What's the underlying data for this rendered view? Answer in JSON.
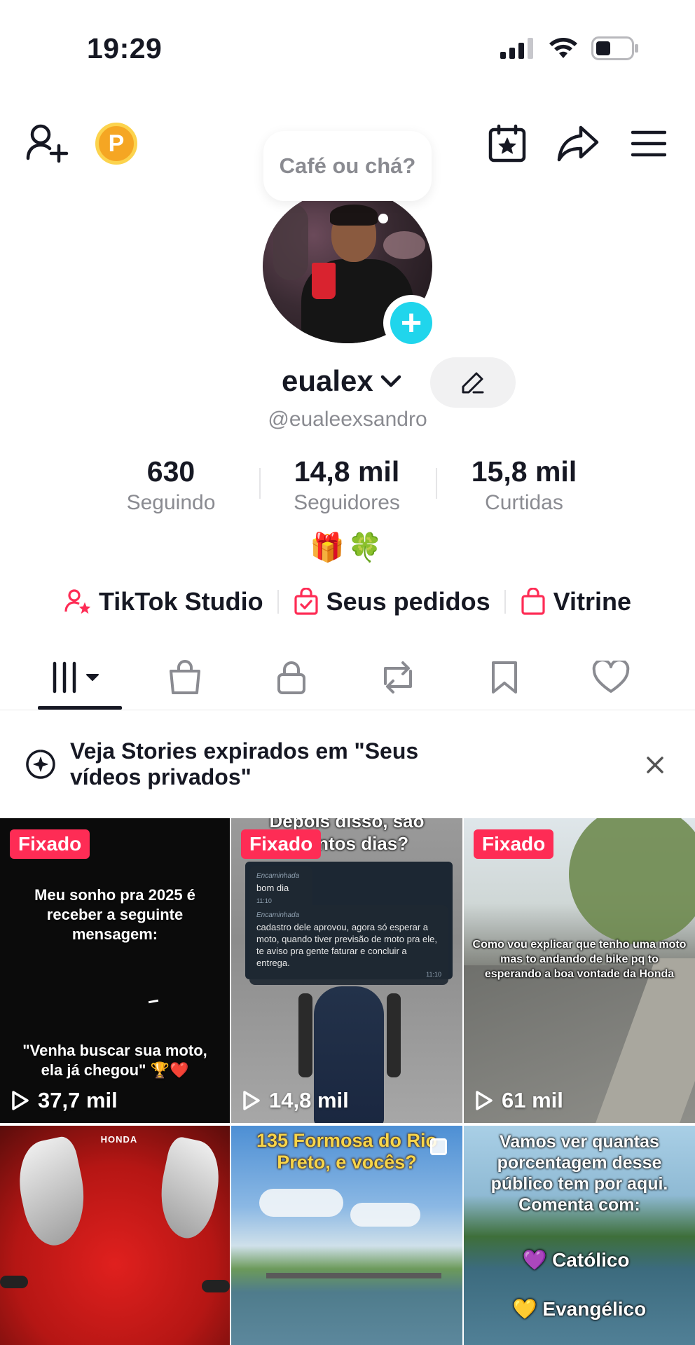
{
  "status": {
    "time": "19:29"
  },
  "bubble": {
    "text": "Café ou chá?"
  },
  "profile": {
    "username": "eualex",
    "handle": "@eualeexsandro",
    "emojis": "🎁🍀"
  },
  "stats": [
    {
      "value": "630",
      "label": "Seguindo"
    },
    {
      "value": "14,8 mil",
      "label": "Seguidores"
    },
    {
      "value": "15,8 mil",
      "label": "Curtidas"
    }
  ],
  "links": [
    {
      "label": "TikTok Studio"
    },
    {
      "label": "Seus pedidos"
    },
    {
      "label": "Vitrine"
    }
  ],
  "banner": {
    "text": "Veja Stories expirados em \"Seus vídeos privados\""
  },
  "videos": [
    {
      "pinned": "Fixado",
      "views": "37,7 mil",
      "caption_top": "Meu sonho pra 2025 é receber a seguinte mensagem:",
      "caption_bottom": "\"Venha buscar sua moto, ela já chegou\" 🏆❤️"
    },
    {
      "pinned": "Fixado",
      "views": "14,8 mil",
      "caption_top": "Depois disso, são quantos dias?",
      "chat_label_1": "Encaminhada",
      "chat_msg_1": "bom dia",
      "chat_time_1": "11:10",
      "chat_label_2": "Encaminhada",
      "chat_msg_2": "cadastro dele aprovou, agora só esperar a moto, quando tiver previsão de moto pra ele, te aviso pra gente faturar e concluir a entrega.",
      "chat_time_2": "11:10"
    },
    {
      "pinned": "Fixado",
      "views": "61 mil",
      "caption_top": "Como vou explicar que tenho uma moto mas to andando de bike pq to esperando a boa vontade da Honda"
    },
    {
      "brand": "HONDA"
    },
    {
      "caption_top": "135 Formosa do Rio Preto, e vocês?"
    },
    {
      "caption_top": "Vamos ver quantas porcentagem desse público tem por aqui. Comenta com:",
      "option_1": "💜 Católico",
      "option_2": "💛 Evangélico"
    }
  ]
}
